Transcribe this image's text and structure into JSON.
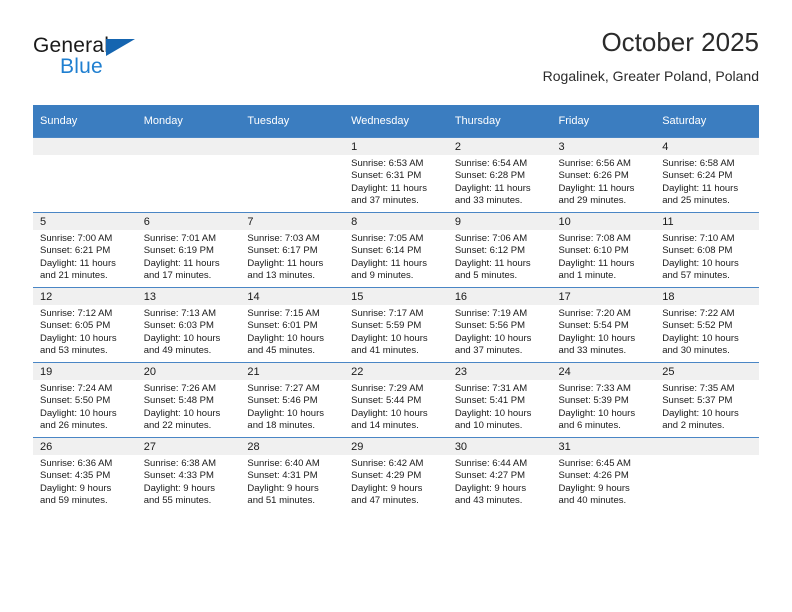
{
  "brand": {
    "line1": "General",
    "line2": "Blue",
    "triangle_color": "#1565b0",
    "blue_text_color": "#1f7fd0"
  },
  "header": {
    "title": "October 2025",
    "subtitle": "Rogalinek, Greater Poland, Poland"
  },
  "theme": {
    "header_bg": "#3b7dc0",
    "daynum_bg": "#f0f0f0",
    "text": "#1a1a1a"
  },
  "weekdays": [
    "Sunday",
    "Monday",
    "Tuesday",
    "Wednesday",
    "Thursday",
    "Friday",
    "Saturday"
  ],
  "labels": {
    "sunrise": "Sunrise:",
    "sunset": "Sunset:",
    "daylight": "Daylight:"
  },
  "weeks": [
    [
      {
        "day": "",
        "sunrise": "",
        "sunset": "",
        "daylight_line1": "",
        "daylight_line2": ""
      },
      {
        "day": "",
        "sunrise": "",
        "sunset": "",
        "daylight_line1": "",
        "daylight_line2": ""
      },
      {
        "day": "",
        "sunrise": "",
        "sunset": "",
        "daylight_line1": "",
        "daylight_line2": ""
      },
      {
        "day": "1",
        "sunrise": "Sunrise: 6:53 AM",
        "sunset": "Sunset: 6:31 PM",
        "daylight_line1": "Daylight: 11 hours",
        "daylight_line2": "and 37 minutes."
      },
      {
        "day": "2",
        "sunrise": "Sunrise: 6:54 AM",
        "sunset": "Sunset: 6:28 PM",
        "daylight_line1": "Daylight: 11 hours",
        "daylight_line2": "and 33 minutes."
      },
      {
        "day": "3",
        "sunrise": "Sunrise: 6:56 AM",
        "sunset": "Sunset: 6:26 PM",
        "daylight_line1": "Daylight: 11 hours",
        "daylight_line2": "and 29 minutes."
      },
      {
        "day": "4",
        "sunrise": "Sunrise: 6:58 AM",
        "sunset": "Sunset: 6:24 PM",
        "daylight_line1": "Daylight: 11 hours",
        "daylight_line2": "and 25 minutes."
      }
    ],
    [
      {
        "day": "5",
        "sunrise": "Sunrise: 7:00 AM",
        "sunset": "Sunset: 6:21 PM",
        "daylight_line1": "Daylight: 11 hours",
        "daylight_line2": "and 21 minutes."
      },
      {
        "day": "6",
        "sunrise": "Sunrise: 7:01 AM",
        "sunset": "Sunset: 6:19 PM",
        "daylight_line1": "Daylight: 11 hours",
        "daylight_line2": "and 17 minutes."
      },
      {
        "day": "7",
        "sunrise": "Sunrise: 7:03 AM",
        "sunset": "Sunset: 6:17 PM",
        "daylight_line1": "Daylight: 11 hours",
        "daylight_line2": "and 13 minutes."
      },
      {
        "day": "8",
        "sunrise": "Sunrise: 7:05 AM",
        "sunset": "Sunset: 6:14 PM",
        "daylight_line1": "Daylight: 11 hours",
        "daylight_line2": "and 9 minutes."
      },
      {
        "day": "9",
        "sunrise": "Sunrise: 7:06 AM",
        "sunset": "Sunset: 6:12 PM",
        "daylight_line1": "Daylight: 11 hours",
        "daylight_line2": "and 5 minutes."
      },
      {
        "day": "10",
        "sunrise": "Sunrise: 7:08 AM",
        "sunset": "Sunset: 6:10 PM",
        "daylight_line1": "Daylight: 11 hours",
        "daylight_line2": "and 1 minute."
      },
      {
        "day": "11",
        "sunrise": "Sunrise: 7:10 AM",
        "sunset": "Sunset: 6:08 PM",
        "daylight_line1": "Daylight: 10 hours",
        "daylight_line2": "and 57 minutes."
      }
    ],
    [
      {
        "day": "12",
        "sunrise": "Sunrise: 7:12 AM",
        "sunset": "Sunset: 6:05 PM",
        "daylight_line1": "Daylight: 10 hours",
        "daylight_line2": "and 53 minutes."
      },
      {
        "day": "13",
        "sunrise": "Sunrise: 7:13 AM",
        "sunset": "Sunset: 6:03 PM",
        "daylight_line1": "Daylight: 10 hours",
        "daylight_line2": "and 49 minutes."
      },
      {
        "day": "14",
        "sunrise": "Sunrise: 7:15 AM",
        "sunset": "Sunset: 6:01 PM",
        "daylight_line1": "Daylight: 10 hours",
        "daylight_line2": "and 45 minutes."
      },
      {
        "day": "15",
        "sunrise": "Sunrise: 7:17 AM",
        "sunset": "Sunset: 5:59 PM",
        "daylight_line1": "Daylight: 10 hours",
        "daylight_line2": "and 41 minutes."
      },
      {
        "day": "16",
        "sunrise": "Sunrise: 7:19 AM",
        "sunset": "Sunset: 5:56 PM",
        "daylight_line1": "Daylight: 10 hours",
        "daylight_line2": "and 37 minutes."
      },
      {
        "day": "17",
        "sunrise": "Sunrise: 7:20 AM",
        "sunset": "Sunset: 5:54 PM",
        "daylight_line1": "Daylight: 10 hours",
        "daylight_line2": "and 33 minutes."
      },
      {
        "day": "18",
        "sunrise": "Sunrise: 7:22 AM",
        "sunset": "Sunset: 5:52 PM",
        "daylight_line1": "Daylight: 10 hours",
        "daylight_line2": "and 30 minutes."
      }
    ],
    [
      {
        "day": "19",
        "sunrise": "Sunrise: 7:24 AM",
        "sunset": "Sunset: 5:50 PM",
        "daylight_line1": "Daylight: 10 hours",
        "daylight_line2": "and 26 minutes."
      },
      {
        "day": "20",
        "sunrise": "Sunrise: 7:26 AM",
        "sunset": "Sunset: 5:48 PM",
        "daylight_line1": "Daylight: 10 hours",
        "daylight_line2": "and 22 minutes."
      },
      {
        "day": "21",
        "sunrise": "Sunrise: 7:27 AM",
        "sunset": "Sunset: 5:46 PM",
        "daylight_line1": "Daylight: 10 hours",
        "daylight_line2": "and 18 minutes."
      },
      {
        "day": "22",
        "sunrise": "Sunrise: 7:29 AM",
        "sunset": "Sunset: 5:44 PM",
        "daylight_line1": "Daylight: 10 hours",
        "daylight_line2": "and 14 minutes."
      },
      {
        "day": "23",
        "sunrise": "Sunrise: 7:31 AM",
        "sunset": "Sunset: 5:41 PM",
        "daylight_line1": "Daylight: 10 hours",
        "daylight_line2": "and 10 minutes."
      },
      {
        "day": "24",
        "sunrise": "Sunrise: 7:33 AM",
        "sunset": "Sunset: 5:39 PM",
        "daylight_line1": "Daylight: 10 hours",
        "daylight_line2": "and 6 minutes."
      },
      {
        "day": "25",
        "sunrise": "Sunrise: 7:35 AM",
        "sunset": "Sunset: 5:37 PM",
        "daylight_line1": "Daylight: 10 hours",
        "daylight_line2": "and 2 minutes."
      }
    ],
    [
      {
        "day": "26",
        "sunrise": "Sunrise: 6:36 AM",
        "sunset": "Sunset: 4:35 PM",
        "daylight_line1": "Daylight: 9 hours",
        "daylight_line2": "and 59 minutes."
      },
      {
        "day": "27",
        "sunrise": "Sunrise: 6:38 AM",
        "sunset": "Sunset: 4:33 PM",
        "daylight_line1": "Daylight: 9 hours",
        "daylight_line2": "and 55 minutes."
      },
      {
        "day": "28",
        "sunrise": "Sunrise: 6:40 AM",
        "sunset": "Sunset: 4:31 PM",
        "daylight_line1": "Daylight: 9 hours",
        "daylight_line2": "and 51 minutes."
      },
      {
        "day": "29",
        "sunrise": "Sunrise: 6:42 AM",
        "sunset": "Sunset: 4:29 PM",
        "daylight_line1": "Daylight: 9 hours",
        "daylight_line2": "and 47 minutes."
      },
      {
        "day": "30",
        "sunrise": "Sunrise: 6:44 AM",
        "sunset": "Sunset: 4:27 PM",
        "daylight_line1": "Daylight: 9 hours",
        "daylight_line2": "and 43 minutes."
      },
      {
        "day": "31",
        "sunrise": "Sunrise: 6:45 AM",
        "sunset": "Sunset: 4:26 PM",
        "daylight_line1": "Daylight: 9 hours",
        "daylight_line2": "and 40 minutes."
      },
      {
        "day": "",
        "sunrise": "",
        "sunset": "",
        "daylight_line1": "",
        "daylight_line2": ""
      }
    ]
  ]
}
